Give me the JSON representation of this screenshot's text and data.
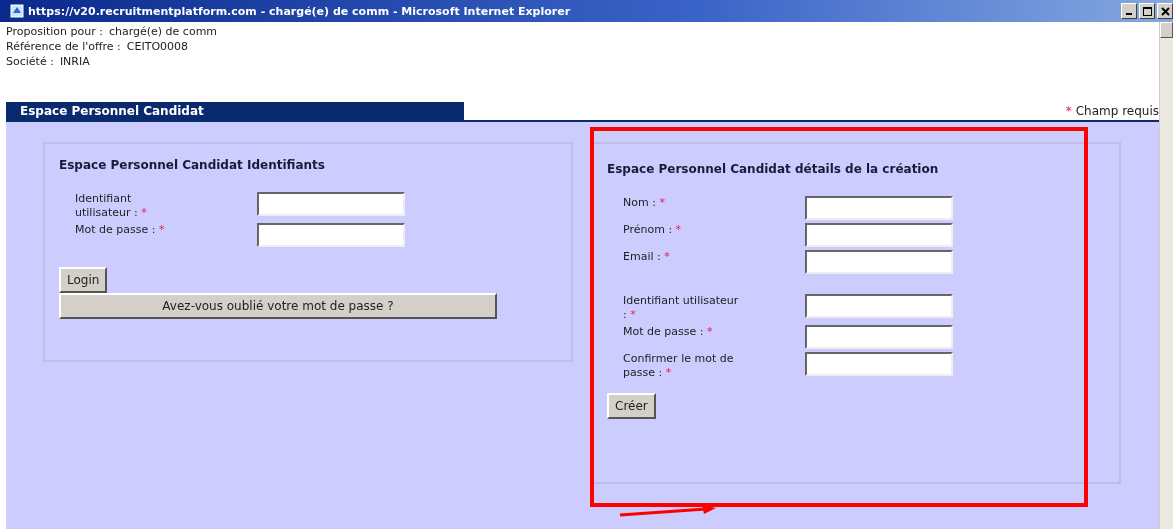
{
  "window": {
    "title": "https://v20.recruitmentplatform.com - chargé(e) de comm - Microsoft Internet Explorer"
  },
  "offer_info": [
    {
      "label": "Proposition pour :",
      "value": "chargé(e) de comm"
    },
    {
      "label": "Référence de l'offre :",
      "value": "CEITO0008"
    },
    {
      "label": "Société :",
      "value": "INRIA"
    }
  ],
  "section_tab": {
    "label": "Espace Personnel Candidat"
  },
  "required_legend": {
    "mark": "*",
    "text": "Champ requis"
  },
  "login_panel": {
    "title": "Espace Personnel Candidat Identifiants",
    "fields": [
      {
        "label": "Identifiant utilisateur :",
        "mark": "*"
      },
      {
        "label": "Mot de passe :",
        "mark": "*"
      }
    ],
    "buttons": [
      {
        "label": "Login",
        "kind": "small"
      },
      {
        "label": "Avez-vous oublié votre mot de passe ?",
        "kind": "wide"
      }
    ]
  },
  "create_panel": {
    "title": "Espace Personnel Candidat détails de la création",
    "highlighted": true,
    "field_groups": [
      [
        {
          "label": "Nom :",
          "mark": "*"
        },
        {
          "label": "Prénom :",
          "mark": "*"
        },
        {
          "label": "Email :",
          "mark": "*"
        }
      ],
      [
        {
          "label": "Identifiant utilisateur :",
          "mark": "*"
        },
        {
          "label": "Mot de passe :",
          "mark": "*"
        },
        {
          "label": "Confirmer le mot de passe :",
          "mark": "*"
        }
      ]
    ],
    "button": {
      "label": "Créer"
    }
  }
}
